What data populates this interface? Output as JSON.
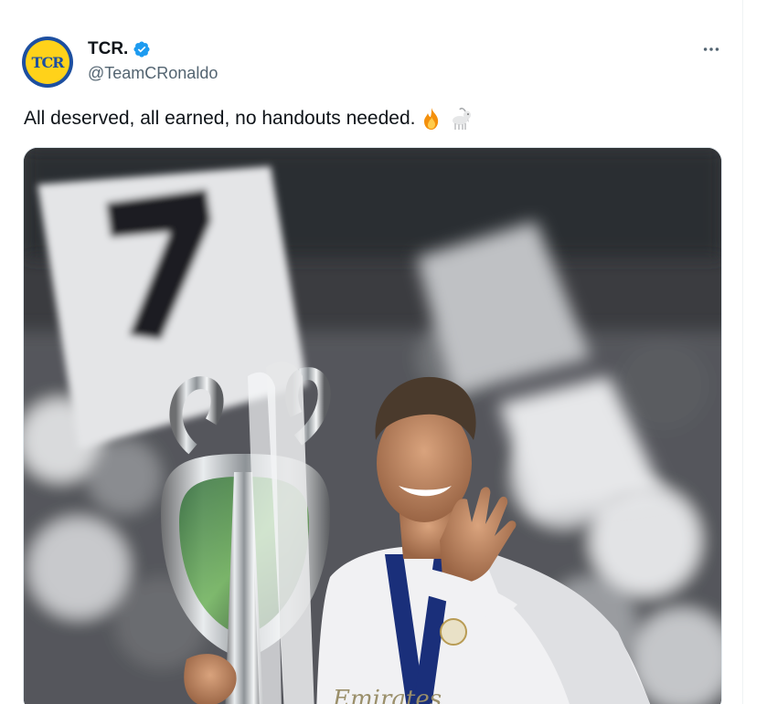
{
  "tweet": {
    "author": {
      "display_name": "TCR.",
      "handle": "@TeamCRonaldo",
      "avatar_text": "TCR",
      "verified": true
    },
    "text": "All deserved, all earned, no handouts needed.",
    "emojis": [
      "fire-emoji",
      "goat-emoji"
    ],
    "media": {
      "kind": "photo",
      "jersey_number": "7",
      "shirt_sponsor": "Emirates"
    }
  },
  "colors": {
    "verified_blue": "#1d9bf0",
    "text_primary": "#0f1419",
    "text_secondary": "#536471",
    "avatar_ring": "#1d4fa0",
    "avatar_fill": "#ffd21a"
  },
  "icons": {
    "verified": "verified-badge-icon",
    "more": "more-horizontal-icon"
  }
}
